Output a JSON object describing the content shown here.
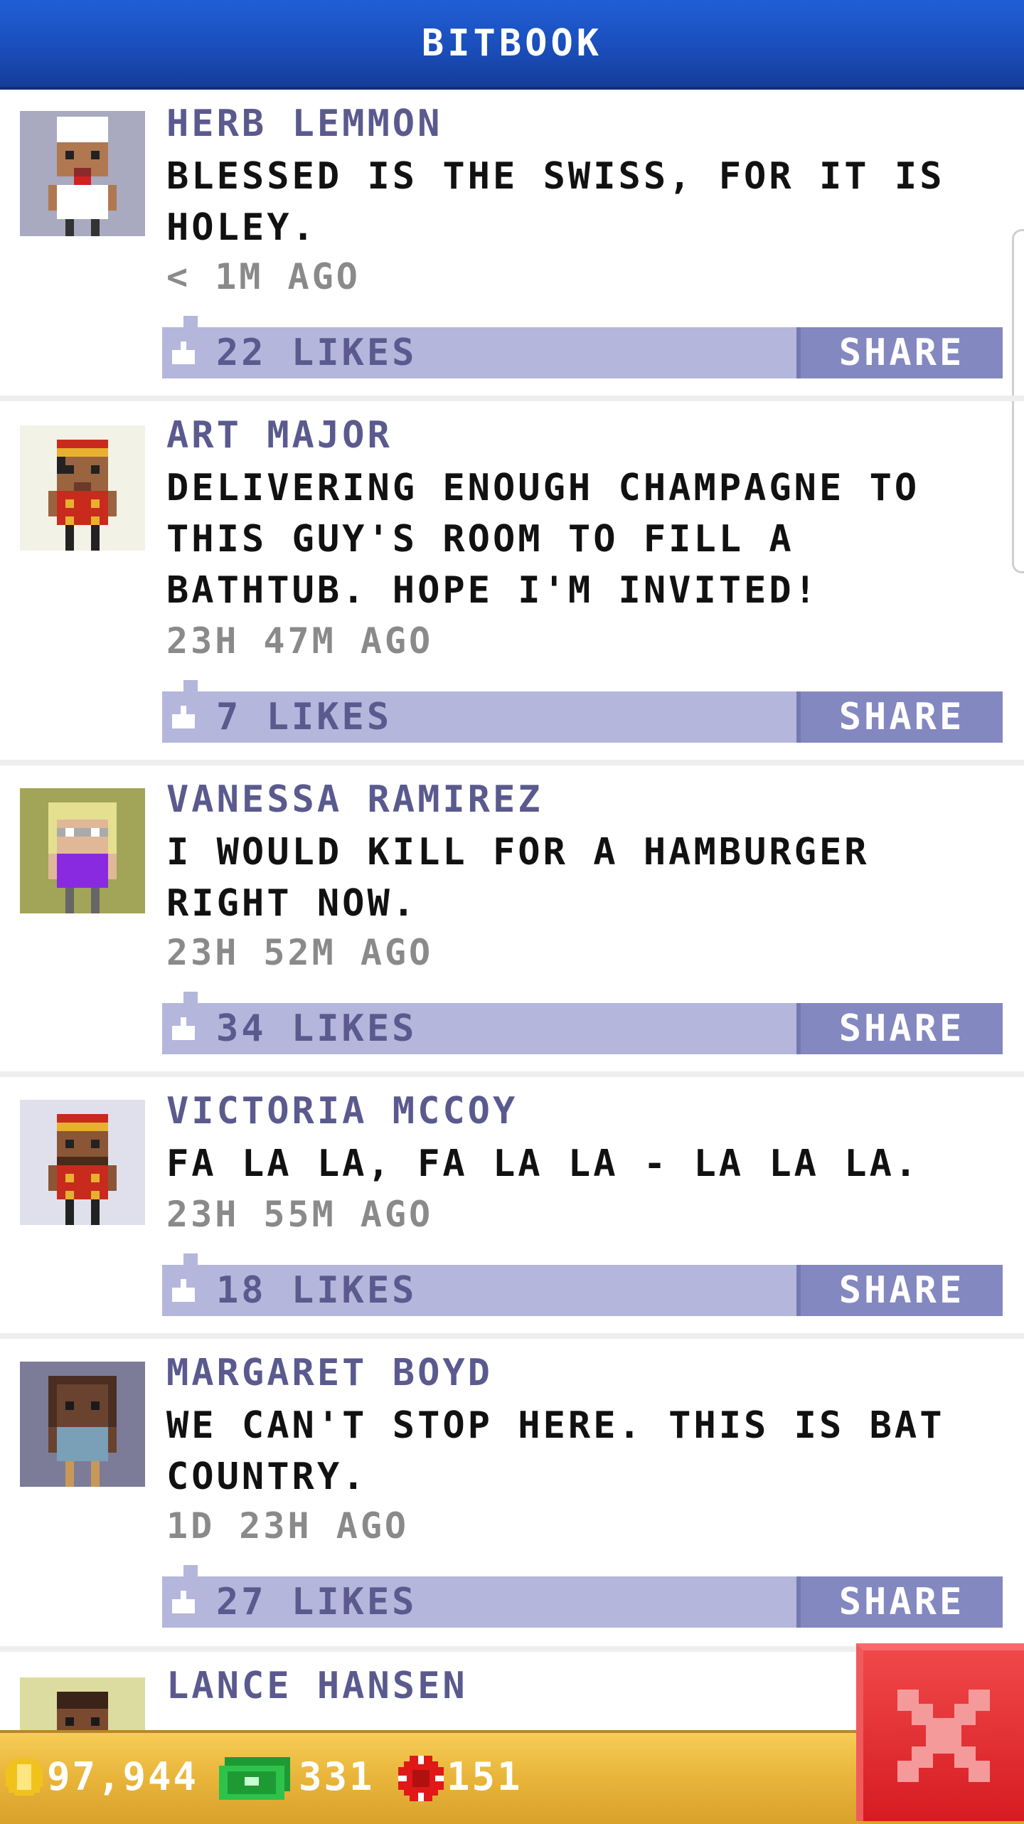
{
  "app": {
    "title": "BITBOOK"
  },
  "posts": [
    {
      "name": "HERB LEMMON",
      "message": "BLESSED IS THE SWISS, FOR IT IS HOLEY.",
      "time": "< 1M AGO",
      "likes": "22 LIKES",
      "share_label": "SHARE",
      "avatar_icon": "chef-avatar-icon",
      "avatar_bg": "#a9a9bf"
    },
    {
      "name": "ART MAJOR",
      "message": "DELIVERING ENOUGH CHAMPAGNE TO THIS GUY'S ROOM TO FILL A BATHTUB. HOPE I'M INVITED!",
      "time": "23H 47M AGO",
      "likes": "7 LIKES",
      "share_label": "SHARE",
      "avatar_icon": "bellhop-avatar-icon",
      "avatar_bg": "#f3f2e6"
    },
    {
      "name": "VANESSA RAMIREZ",
      "message": "I WOULD KILL FOR A HAMBURGER RIGHT NOW.",
      "time": "23H 52M AGO",
      "likes": "34 LIKES",
      "share_label": "SHARE",
      "avatar_icon": "blonde-woman-avatar-icon",
      "avatar_bg": "#a2a458"
    },
    {
      "name": "VICTORIA MCCOY",
      "message": "FA LA LA, FA LA LA - LA LA LA.",
      "time": "23H 55M AGO",
      "likes": "18 LIKES",
      "share_label": "SHARE",
      "avatar_icon": "bellhop-avatar-icon",
      "avatar_bg": "#e0e0ec"
    },
    {
      "name": "MARGARET BOYD",
      "message": "WE CAN'T STOP HERE. THIS IS BAT COUNTRY.",
      "time": "1D 23H AGO",
      "likes": "27 LIKES",
      "share_label": "SHARE",
      "avatar_icon": "woman-avatar-icon",
      "avatar_bg": "#7c7c98"
    },
    {
      "name": "LANCE HANSEN",
      "avatar_icon": "man-avatar-icon",
      "avatar_bg": "#dcdca0"
    }
  ],
  "currency": {
    "coins": "97,944",
    "bux": "331",
    "chips": "151"
  },
  "colors": {
    "header": "#1a4cb8",
    "like_bar": "#b4b6dc",
    "share_button": "#8488c0",
    "name_text": "#5a5a8e",
    "bottom_bar": "#e8b43a",
    "close_button": "#d61c22"
  }
}
